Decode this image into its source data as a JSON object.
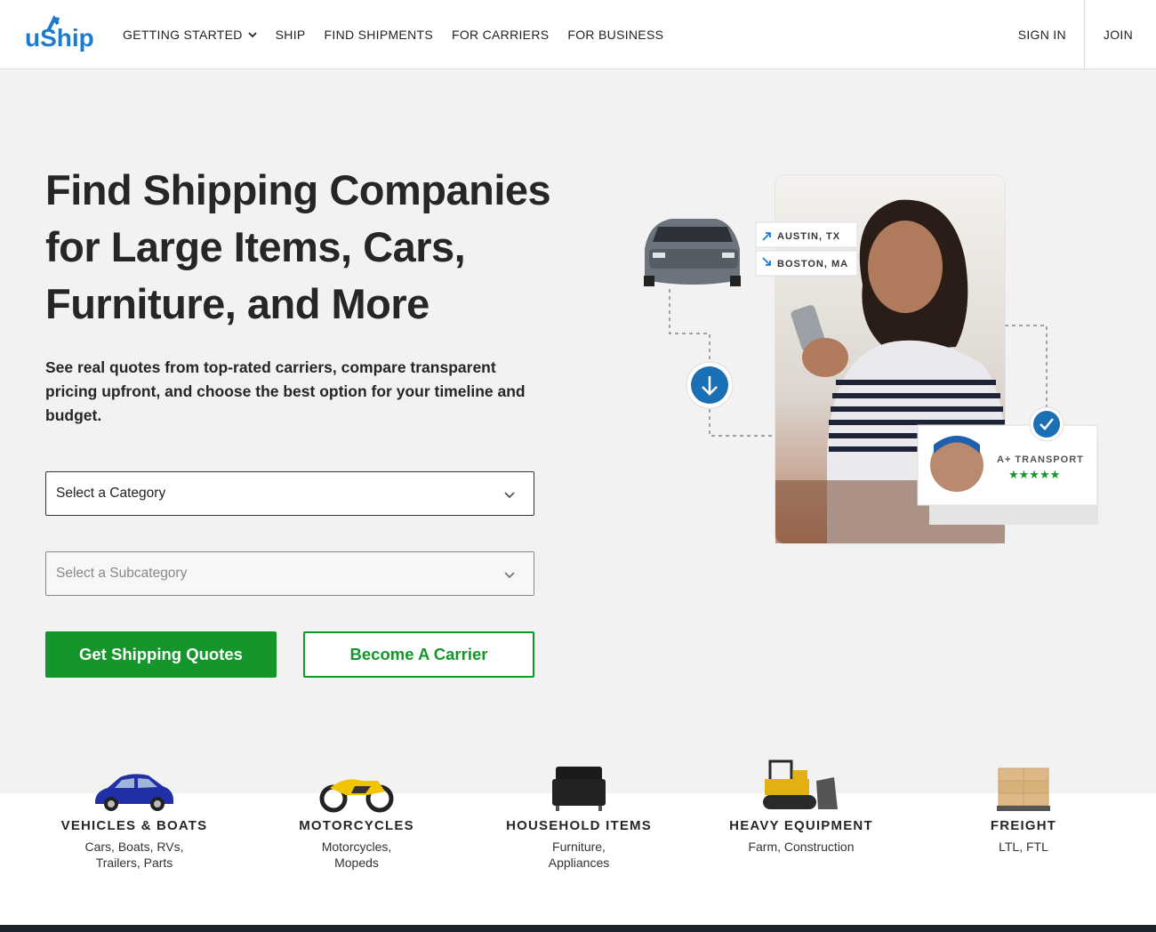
{
  "brand": {
    "logo_text": "uShip",
    "accent": "#14962a",
    "logo_color": "#1a7bd1"
  },
  "nav": {
    "items": [
      {
        "label": "GETTING STARTED",
        "has_dropdown": true
      },
      {
        "label": "SHIP"
      },
      {
        "label": "FIND SHIPMENTS"
      },
      {
        "label": "FOR CARRIERS"
      },
      {
        "label": "FOR BUSINESS"
      }
    ],
    "sign_in": "SIGN IN",
    "join": "JOIN"
  },
  "hero": {
    "title": "Find Shipping Companies for Large Items, Cars, Furniture, and More",
    "subtitle": "See real quotes from top-rated carriers, compare transparent pricing upfront, and choose the best option for your timeline and budget.",
    "category_select": "Select a Category",
    "subcategory_select": "Select a Subcategory",
    "primary_button": "Get Shipping Quotes",
    "secondary_button": "Become A Carrier"
  },
  "illustration": {
    "origin": "AUSTIN, TX",
    "destination": "BOSTON, MA",
    "carrier_name": "A+ TRANSPORT",
    "rating_stars": 5
  },
  "categories": [
    {
      "name": "VEHICLES & BOATS",
      "desc": "Cars, Boats, RVs, Trailers, Parts",
      "icon": "car-icon"
    },
    {
      "name": "MOTORCYCLES",
      "desc": "Motorcycles, Mopeds",
      "icon": "motorcycle-icon"
    },
    {
      "name": "HOUSEHOLD ITEMS",
      "desc": "Furniture, Appliances",
      "icon": "armchair-icon"
    },
    {
      "name": "HEAVY EQUIPMENT",
      "desc": "Farm, Construction",
      "icon": "bulldozer-icon"
    },
    {
      "name": "FREIGHT",
      "desc": "LTL, FTL",
      "icon": "pallet-icon"
    }
  ]
}
